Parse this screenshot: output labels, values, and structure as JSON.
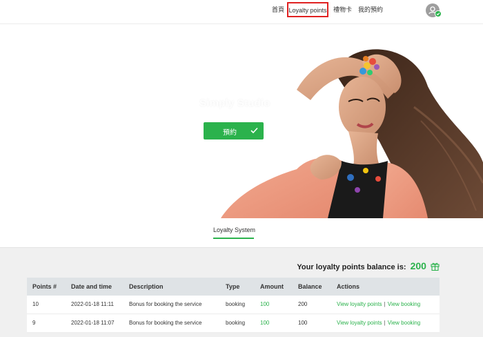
{
  "nav": {
    "home": "首頁",
    "loyalty": "Loyalty points",
    "gift_card": "禮物卡",
    "my_bookings": "我的預約"
  },
  "hero": {
    "title": "Simply Studio",
    "book_button": "預約"
  },
  "tab": {
    "label": "Loyalty System"
  },
  "balance": {
    "label": "Your loyalty points balance is:",
    "value": "200"
  },
  "table": {
    "headers": {
      "points": "Points #",
      "date": "Date and time",
      "description": "Description",
      "type": "Type",
      "amount": "Amount",
      "balance": "Balance",
      "actions": "Actions"
    },
    "rows": [
      {
        "points": "10",
        "date": "2022-01-18 11:11",
        "description": "Bonus for booking the service",
        "type": "booking",
        "amount": "100",
        "balance": "200",
        "action_points": "View loyalty points",
        "separator": "|",
        "action_booking": "View booking"
      },
      {
        "points": "9",
        "date": "2022-01-18 11:07",
        "description": "Bonus for booking the service",
        "type": "booking",
        "amount": "100",
        "balance": "100",
        "action_points": "View loyalty points",
        "separator": "|",
        "action_booking": "View booking"
      }
    ]
  },
  "colors": {
    "accent": "#2bb24c",
    "highlight_border": "#e02020",
    "table_header_bg": "#dfe3e6",
    "content_bg": "#f0f0f0"
  },
  "icons": {
    "avatar": "user-icon",
    "avatar_badge": "check-icon",
    "book_button": "check-icon",
    "balance": "gift-icon"
  }
}
